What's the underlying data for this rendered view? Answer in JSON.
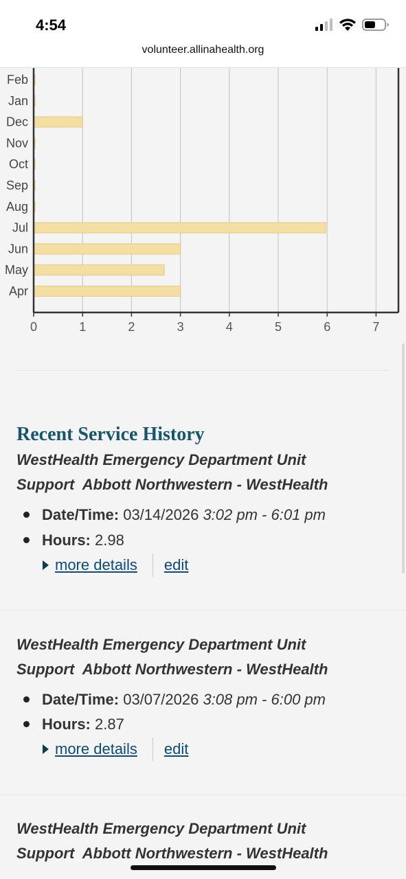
{
  "status_bar": {
    "time": "4:54",
    "url": "volunteer.allinahealth.org",
    "battery_fraction": 0.55
  },
  "chart_data": {
    "type": "bar",
    "orientation": "horizontal",
    "categories": [
      "Feb",
      "Jan",
      "Dec",
      "Nov",
      "Oct",
      "Sep",
      "Aug",
      "Jul",
      "Jun",
      "May",
      "Apr"
    ],
    "values": [
      0,
      0,
      1,
      0,
      0,
      0,
      0,
      5.97,
      3,
      2.67,
      3
    ],
    "x_ticks": [
      "0",
      "1",
      "2",
      "3",
      "4",
      "5",
      "6",
      "7"
    ],
    "xlim": [
      0,
      7
    ],
    "grid": true,
    "bar_color": "#f3dfa4",
    "bar_border": "#e8c97a"
  },
  "recent": {
    "title": "Recent Service History",
    "entries": [
      {
        "title_line1": "WestHealth Emergency Department Unit",
        "title_line2": "Support  Abbott Northwestern - WestHealth",
        "datetime_label": "Date/Time:",
        "date": "03/14/2026",
        "time_range": "3:02 pm - 6:01 pm",
        "hours_label": "Hours:",
        "hours": "2.98",
        "more_details": "more details",
        "edit": "edit"
      },
      {
        "title_line1": "WestHealth Emergency Department Unit",
        "title_line2": "Support  Abbott Northwestern - WestHealth",
        "datetime_label": "Date/Time:",
        "date": "03/07/2026",
        "time_range": "3:08 pm - 6:00 pm",
        "hours_label": "Hours:",
        "hours": "2.87",
        "more_details": "more details",
        "edit": "edit"
      },
      {
        "title_line1": "WestHealth Emergency Department Unit",
        "title_line2": "Support  Abbott Northwestern - WestHealth"
      }
    ]
  }
}
